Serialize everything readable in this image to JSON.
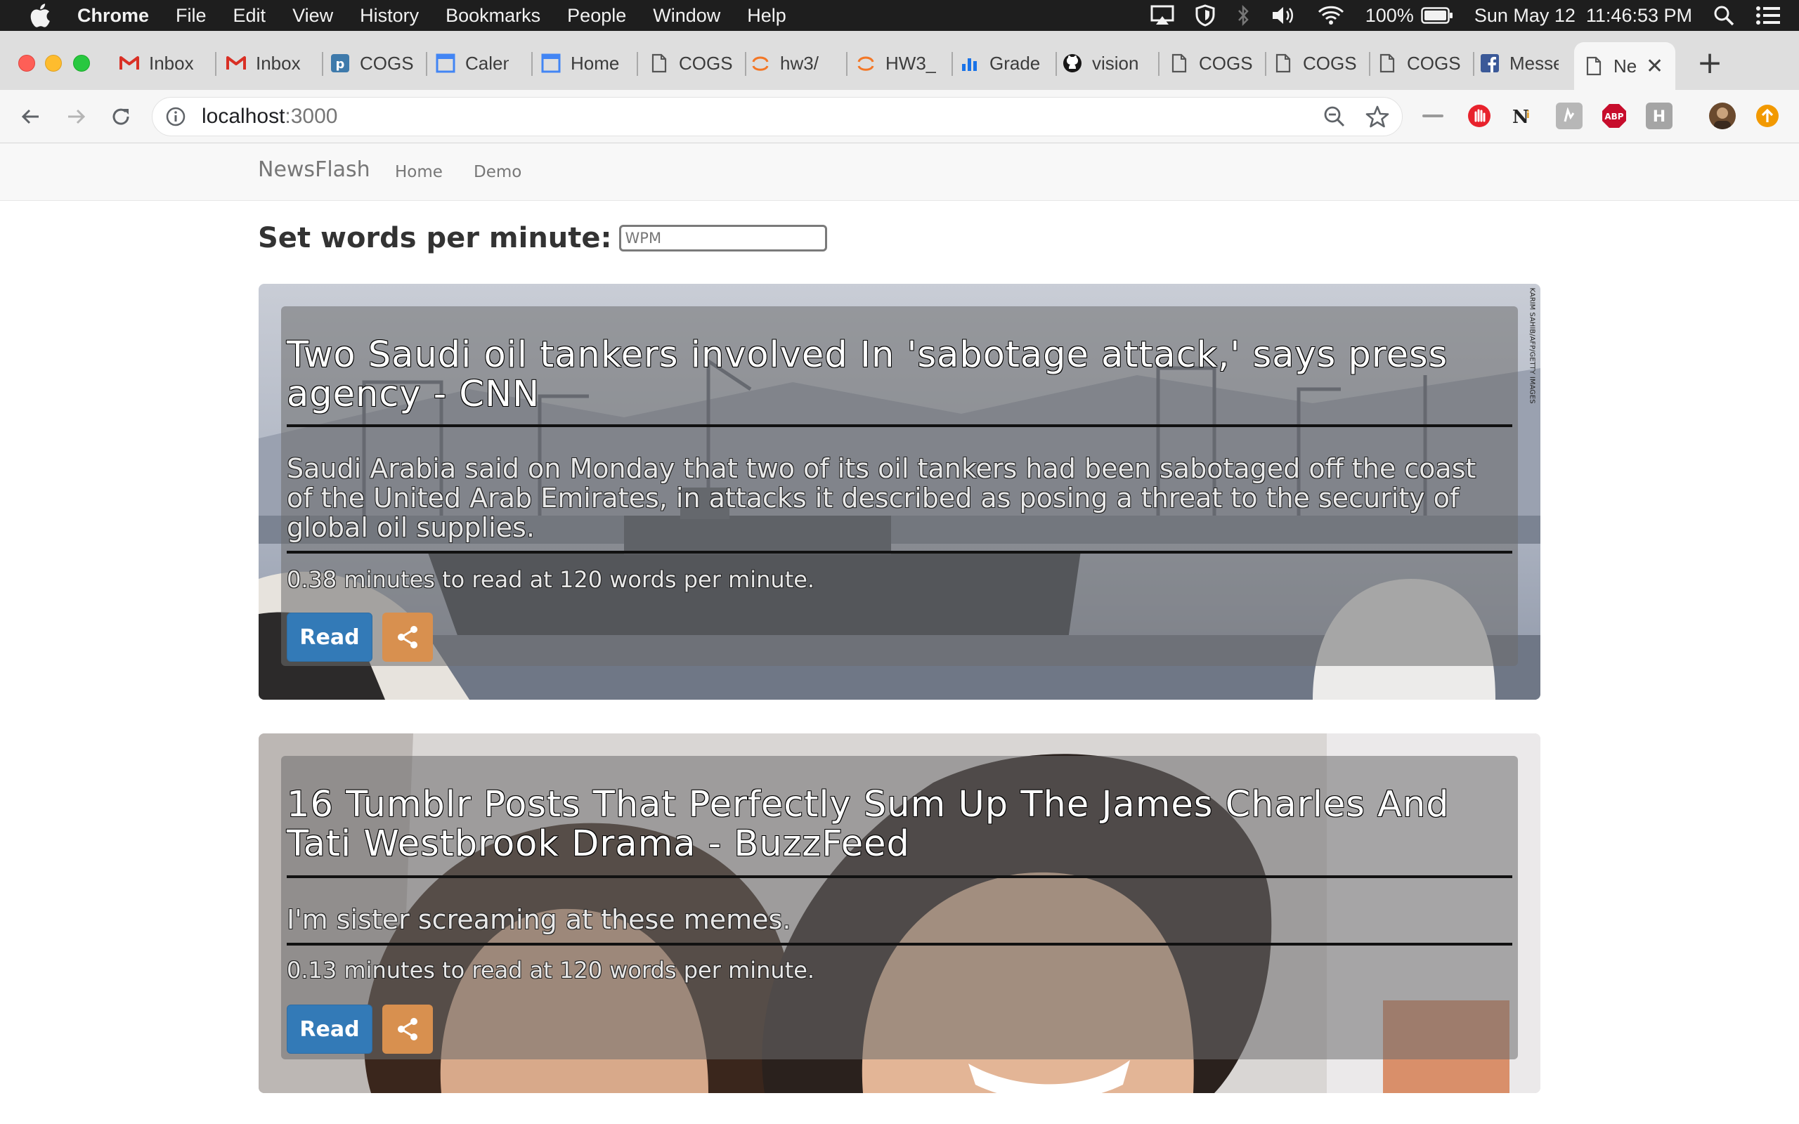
{
  "menubar": {
    "app": "Chrome",
    "items": [
      "File",
      "Edit",
      "View",
      "History",
      "Bookmarks",
      "People",
      "Window",
      "Help"
    ],
    "battery": "100%",
    "clock": "Sun May 12  11:46:53 PM"
  },
  "tabs": [
    {
      "title": "Inbox",
      "icon": "gmail-icon"
    },
    {
      "title": "Inbox",
      "icon": "gmail-icon"
    },
    {
      "title": "COGS",
      "icon": "piazza-icon"
    },
    {
      "title": "Calendar",
      "icon": "calendar-icon"
    },
    {
      "title": "Home",
      "icon": "calendar-icon"
    },
    {
      "title": "COGS",
      "icon": "document-icon"
    },
    {
      "title": "hw3/",
      "icon": "jupyter-icon"
    },
    {
      "title": "HW3_",
      "icon": "jupyter-icon"
    },
    {
      "title": "Grade",
      "icon": "chart-icon"
    },
    {
      "title": "vision",
      "icon": "github-icon"
    },
    {
      "title": "COGS",
      "icon": "document-icon"
    },
    {
      "title": "COGS",
      "icon": "document-icon"
    },
    {
      "title": "COGS",
      "icon": "document-icon"
    },
    {
      "title": "Messenger",
      "icon": "facebook-icon"
    },
    {
      "title": "NewsFlash",
      "icon": "document-icon",
      "active": true
    }
  ],
  "omnibox": {
    "host": "localhost",
    "port": ":3000"
  },
  "site": {
    "brand": "NewsFlash",
    "nav": [
      "Home",
      "Demo"
    ],
    "wpm_label": "Set words per minute:",
    "wpm_placeholder": "WPM"
  },
  "articles": [
    {
      "title": "Two Saudi oil tankers involved In 'sabotage attack,' says press agency - CNN",
      "description": "Saudi Arabia said on Monday that two of its oil tankers had been sabotaged off the coast of the United Arab Emirates, in attacks it described as posing a threat to the security of global oil supplies.",
      "read_time": "0.38 minutes to read at 120 words per minute.",
      "read_label": "Read",
      "photo_credit": "KARIM SAHIB/AFP/GETTY IMAGES"
    },
    {
      "title": "16 Tumblr Posts That Perfectly Sum Up The James Charles And Tati Westbrook Drama - BuzzFeed",
      "description": "I'm sister screaming at these memes.",
      "read_time": "0.13 minutes to read at 120 words per minute.",
      "read_label": "Read"
    }
  ],
  "colors": {
    "read_button": "#337ab7",
    "share_button": "#d8904f"
  }
}
